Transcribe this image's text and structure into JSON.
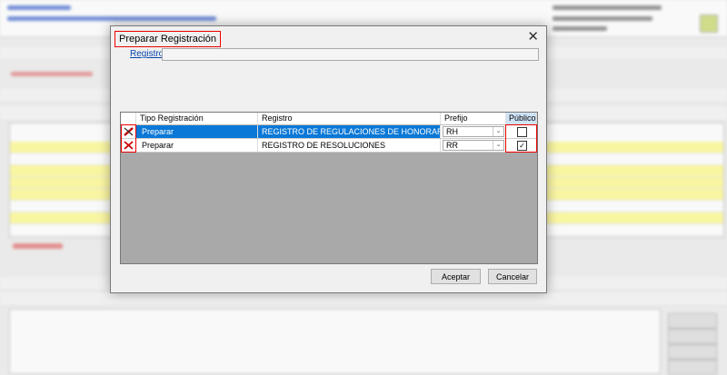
{
  "dialog": {
    "title": "Preparar Registración",
    "registro_label": "Registro :",
    "registro_value": "",
    "columns": [
      "Tipo Registración",
      "Registro",
      "Prefijo",
      "Público"
    ],
    "rows": [
      {
        "tipo": "Preparar",
        "registro": "REGISTRO DE REGULACIONES DE HONORARIOS",
        "prefijo": "RH",
        "publico": false,
        "selected": true
      },
      {
        "tipo": "Preparar",
        "registro": "REGISTRO DE RESOLUCIONES",
        "prefijo": "RR",
        "publico": true,
        "selected": false
      }
    ],
    "accept_label": "Aceptar",
    "cancel_label": "Cancelar",
    "close_glyph": "✕",
    "combo_arrow": "⌄",
    "check_glyph": "✓"
  },
  "colors": {
    "accent_red": "#e00000",
    "selection_blue": "#0a78d7",
    "link_blue": "#0645ad"
  }
}
